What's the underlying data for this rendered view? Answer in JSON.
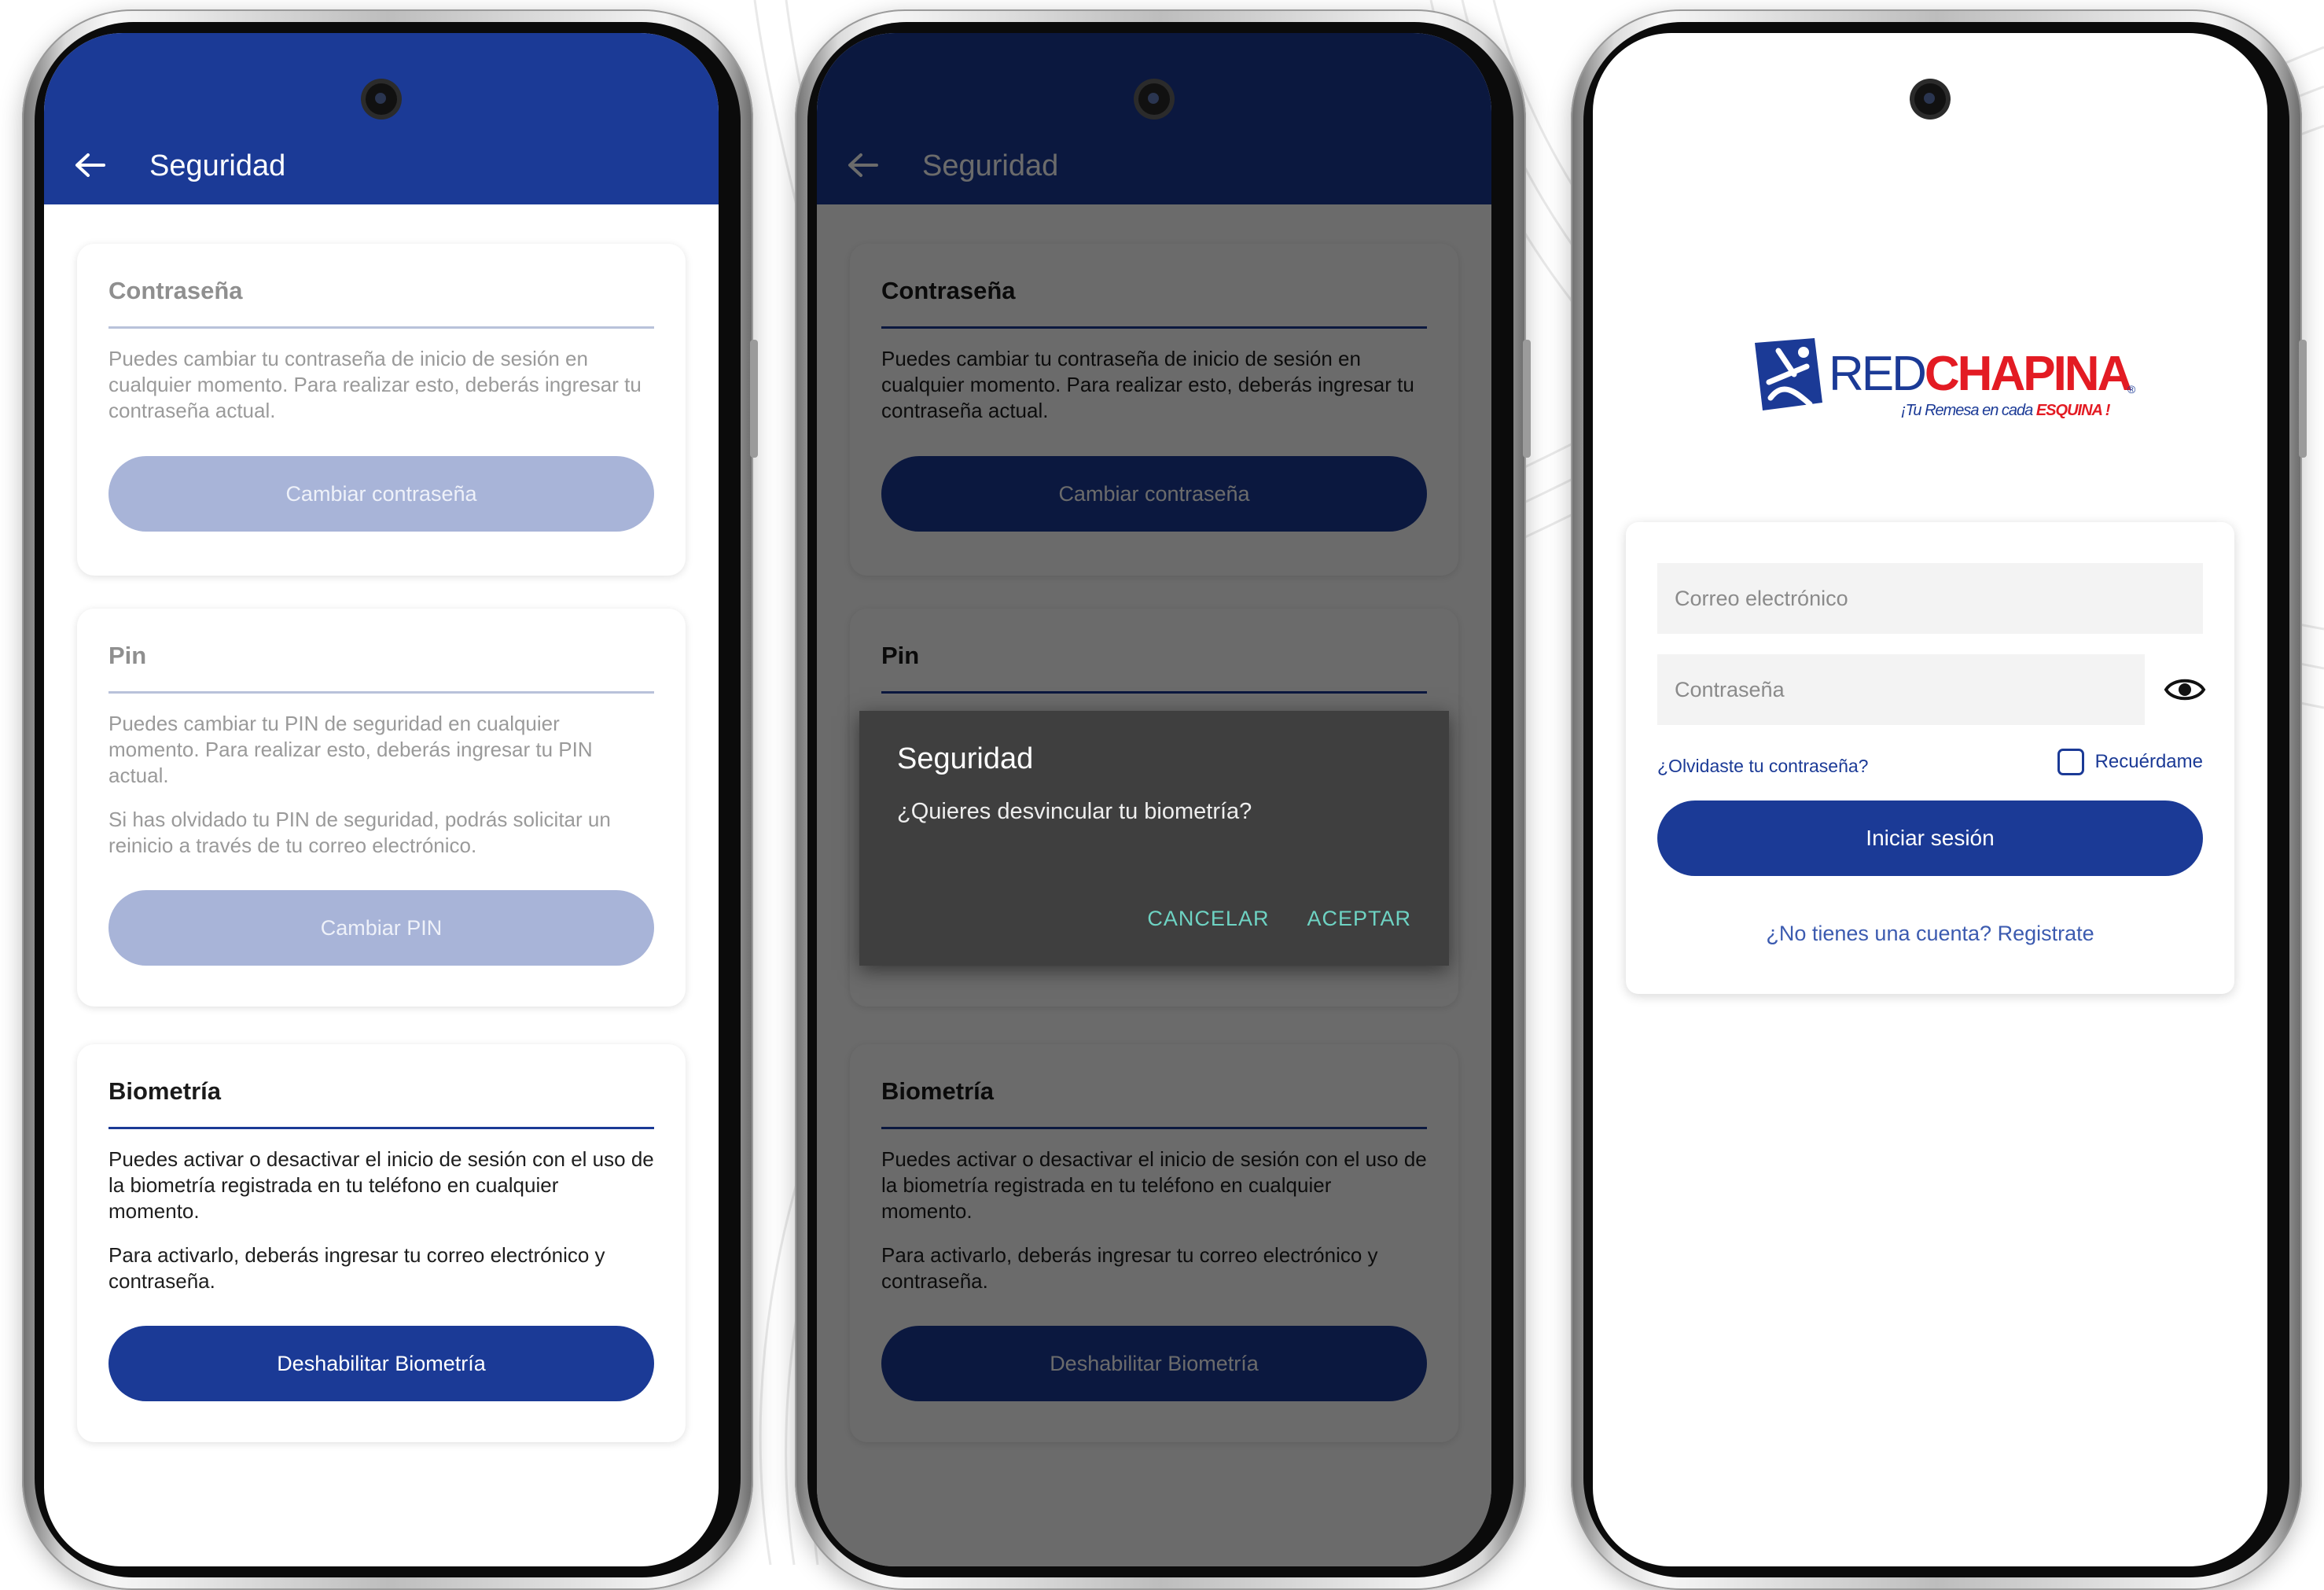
{
  "colors": {
    "brand_blue": "#1b3a96",
    "brand_red": "#e31b23",
    "dialog_accent": "#6ed3c3",
    "disabled_button": "#a8b4d8"
  },
  "security_screen": {
    "header_title": "Seguridad",
    "back_icon": "arrow-left-icon",
    "password_card": {
      "title": "Contraseña",
      "description": "Puedes cambiar tu contraseña de inicio de sesión en cualquier momento. Para realizar esto, deberás ingresar tu contraseña actual.",
      "button_label": "Cambiar contraseña"
    },
    "pin_card": {
      "title": "Pin",
      "description_1": "Puedes cambiar tu PIN de seguridad en cualquier momento. Para realizar esto, deberás ingresar tu PIN actual.",
      "description_2": "Si has olvidado tu PIN de seguridad, podrás solicitar un reinicio a través de tu correo electrónico.",
      "button_label": "Cambiar PIN"
    },
    "biometric_card": {
      "title": "Biometría",
      "description_1": "Puedes activar o desactivar el inicio de sesión con el uso de la biometría registrada en tu teléfono en cualquier momento.",
      "description_2": "Para activarlo, deberás ingresar tu correo electrónico y contraseña.",
      "button_label": "Deshabilitar Biometría"
    }
  },
  "dialog": {
    "title": "Seguridad",
    "message": "¿Quieres desvincular tu biometría?",
    "cancel_label": "CANCELAR",
    "accept_label": "ACEPTAR"
  },
  "login_screen": {
    "logo": {
      "brand_part_1": "RED",
      "brand_part_2": "CHAPINA",
      "tagline_part_1": "¡Tu Remesa en cada ",
      "tagline_part_2": "ESQUINA !",
      "registered_mark": "®"
    },
    "email_placeholder": "Correo electrónico",
    "password_placeholder": "Contraseña",
    "eye_icon": "eye-icon",
    "forgot_password": "¿Olvidaste tu contraseña?",
    "remember_me": "Recuérdame",
    "login_button": "Iniciar sesión",
    "register_link": "¿No tienes una cuenta? Registrate"
  }
}
